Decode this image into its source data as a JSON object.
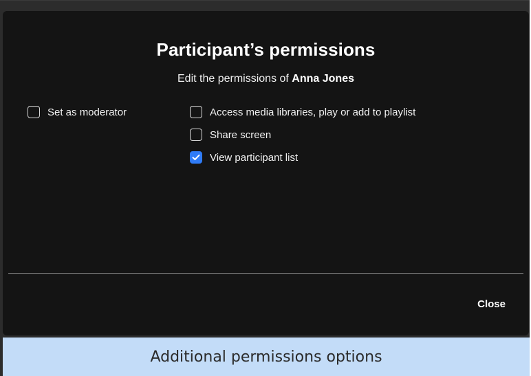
{
  "dialog": {
    "title": "Participant’s permissions",
    "subtitle_prefix": "Edit the permissions of ",
    "participant_name": "Anna Jones",
    "options_left": [
      {
        "label": "Set as moderator",
        "checked": false
      }
    ],
    "options_right": [
      {
        "label": "Access media libraries, play or add to playlist",
        "checked": false
      },
      {
        "label": "Share screen",
        "checked": false
      },
      {
        "label": "View participant list",
        "checked": true
      }
    ],
    "close_label": "Close"
  },
  "caption": {
    "text": "Additional permissions options"
  },
  "colors": {
    "background": "#2c2c2c",
    "modal": "#141414",
    "checkbox_checked": "#2f7bf6",
    "caption_bar": "#c3dcf8"
  }
}
